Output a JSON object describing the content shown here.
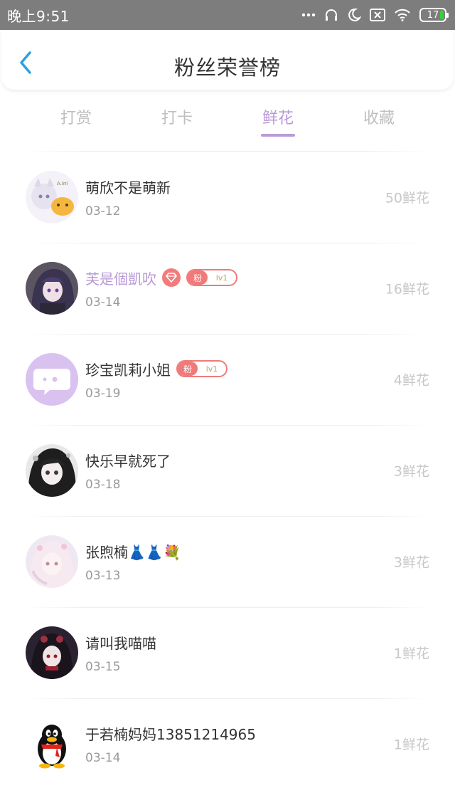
{
  "status_bar": {
    "time": "晚上9:51",
    "battery": "17",
    "icons": [
      "dots-icon",
      "headphones-icon",
      "moon-icon",
      "sim-x-icon",
      "wifi-icon",
      "battery-icon"
    ]
  },
  "header": {
    "title": "粉丝荣誉榜",
    "back_icon": "chevron-left-icon"
  },
  "tabs": [
    {
      "label": "打赏",
      "active": false
    },
    {
      "label": "打卡",
      "active": false
    },
    {
      "label": "鲜花",
      "active": true
    },
    {
      "label": "收藏",
      "active": false
    }
  ],
  "fans": [
    {
      "name": "萌欣不是萌新",
      "date": "03-12",
      "count": "50鲜花"
    },
    {
      "name": "芙是個凱吹",
      "date": "03-14",
      "count": "16鲜花",
      "badge_left": "粉",
      "badge_right": "lv1"
    },
    {
      "name": "珍宝凯莉小姐",
      "date": "03-19",
      "count": "4鲜花",
      "badge_left": "粉",
      "badge_right": "lv1"
    },
    {
      "name": "快乐早就死了",
      "date": "03-18",
      "count": "3鲜花"
    },
    {
      "name": "张煦楠👗👗💐",
      "date": "03-13",
      "count": "3鲜花"
    },
    {
      "name": "请叫我喵喵",
      "date": "03-15",
      "count": "1鲜花"
    },
    {
      "name": "于若楠妈妈13851214965",
      "date": "03-14",
      "count": "1鲜花"
    }
  ],
  "colors": {
    "accent": "#b99ad6",
    "badge_red": "#f07a7a",
    "status_bar": "#7d7d7d"
  }
}
